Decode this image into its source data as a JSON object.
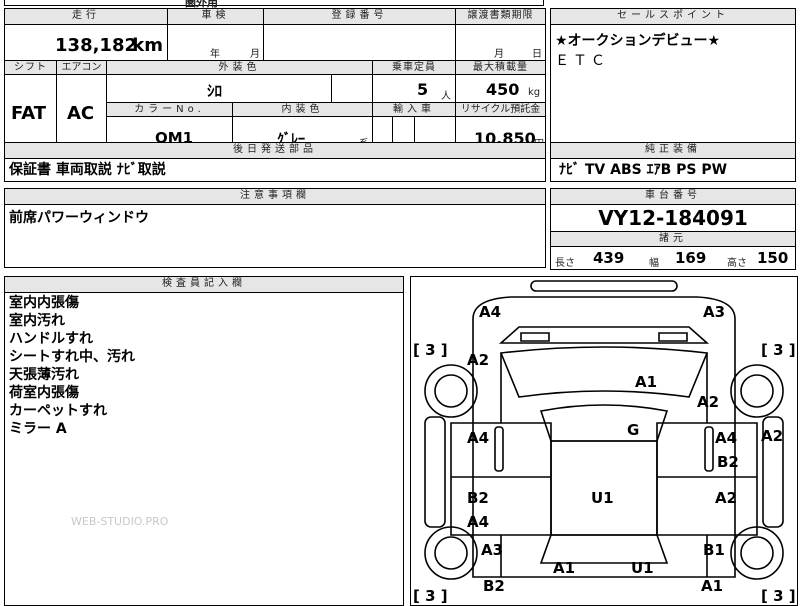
{
  "hidden_header": {
    "fragment": "圏外用"
  },
  "mileage": {
    "label": "走行",
    "value": "138,182",
    "unit": "km"
  },
  "inspection": {
    "label": "車検",
    "year_unit": "年",
    "month_unit": "月"
  },
  "registration": {
    "label": "登録番号"
  },
  "transfer_deadline": {
    "label": "譲渡書類期限",
    "month_unit": "月",
    "day_unit": "日"
  },
  "sales_point": {
    "label": "セールスポイント",
    "lines": [
      "★オークションデビュー★",
      "ＥＴＣ"
    ]
  },
  "shift": {
    "label": "シフト",
    "value": "FAT"
  },
  "aircon": {
    "label": "エアコン",
    "value": "AC"
  },
  "exterior_color": {
    "label": "外装色",
    "value": "ｼﾛ"
  },
  "capacity": {
    "label": "乗車定員",
    "value": "5",
    "unit": "人"
  },
  "max_load": {
    "label": "最大積載量",
    "value": "450",
    "unit": "kg"
  },
  "color_no": {
    "label": "カラーNo.",
    "value": "QM1"
  },
  "interior_color": {
    "label": "内装色",
    "value": "ｸﾞﾚｰ",
    "suffix": "系"
  },
  "import": {
    "label": "輸入車"
  },
  "recycle": {
    "label": "リサイクル預託金",
    "value": "10,850",
    "unit": "円"
  },
  "later_parts": {
    "label": "後日発送部品",
    "value": "保証書 車両取説 ﾅﾋﾞ取説"
  },
  "equipment": {
    "label": "純正装備",
    "value": "ﾅﾋﾞ TV ABS ｴｱB PS PW"
  },
  "notes": {
    "label": "注意事項欄",
    "value": "前席パワーウィンドウ"
  },
  "chassis": {
    "label": "車台番号",
    "value": "VY12-184091"
  },
  "dimensions": {
    "label": "諸元",
    "length_label": "長さ",
    "length": "439",
    "width_label": "幅",
    "width": "169",
    "height_label": "高さ",
    "height": "150"
  },
  "inspector": {
    "label": "検査員記入欄",
    "lines": [
      "室内内張傷",
      "室内汚れ",
      "ハンドルすれ",
      "シートすれ中、汚れ",
      "天張薄汚れ",
      "荷室内張傷",
      "カーペットすれ",
      "ミラー A"
    ]
  },
  "watermark": "WEB-STUDIO.PRO",
  "diagram": {
    "tire_fl": "[ 3 ]",
    "tire_fr": "[ 3 ]",
    "tire_rl": "[ 3 ]",
    "tire_rr": "[ 3 ]",
    "marks": {
      "front_left_corner": "A4",
      "front_right_corner": "A3",
      "left_front_fender": "A2",
      "hood": "A1",
      "right_front_fender": "A2",
      "roof": "G",
      "left_front_door": "A4",
      "right_front_door_a": "A4",
      "right_front_door_b": "B2",
      "right_side_outer": "A2",
      "left_rear_door_a": "B2",
      "left_rear_door_b": "A4",
      "roof_rear": "U1",
      "right_rear_door": "A2",
      "left_rear_fender": "A3",
      "right_rear_fender": "B1",
      "rear_left": "A1",
      "rear_center": "U1",
      "rear_left_bottom": "B2",
      "rear_right_bottom": "A1"
    }
  }
}
